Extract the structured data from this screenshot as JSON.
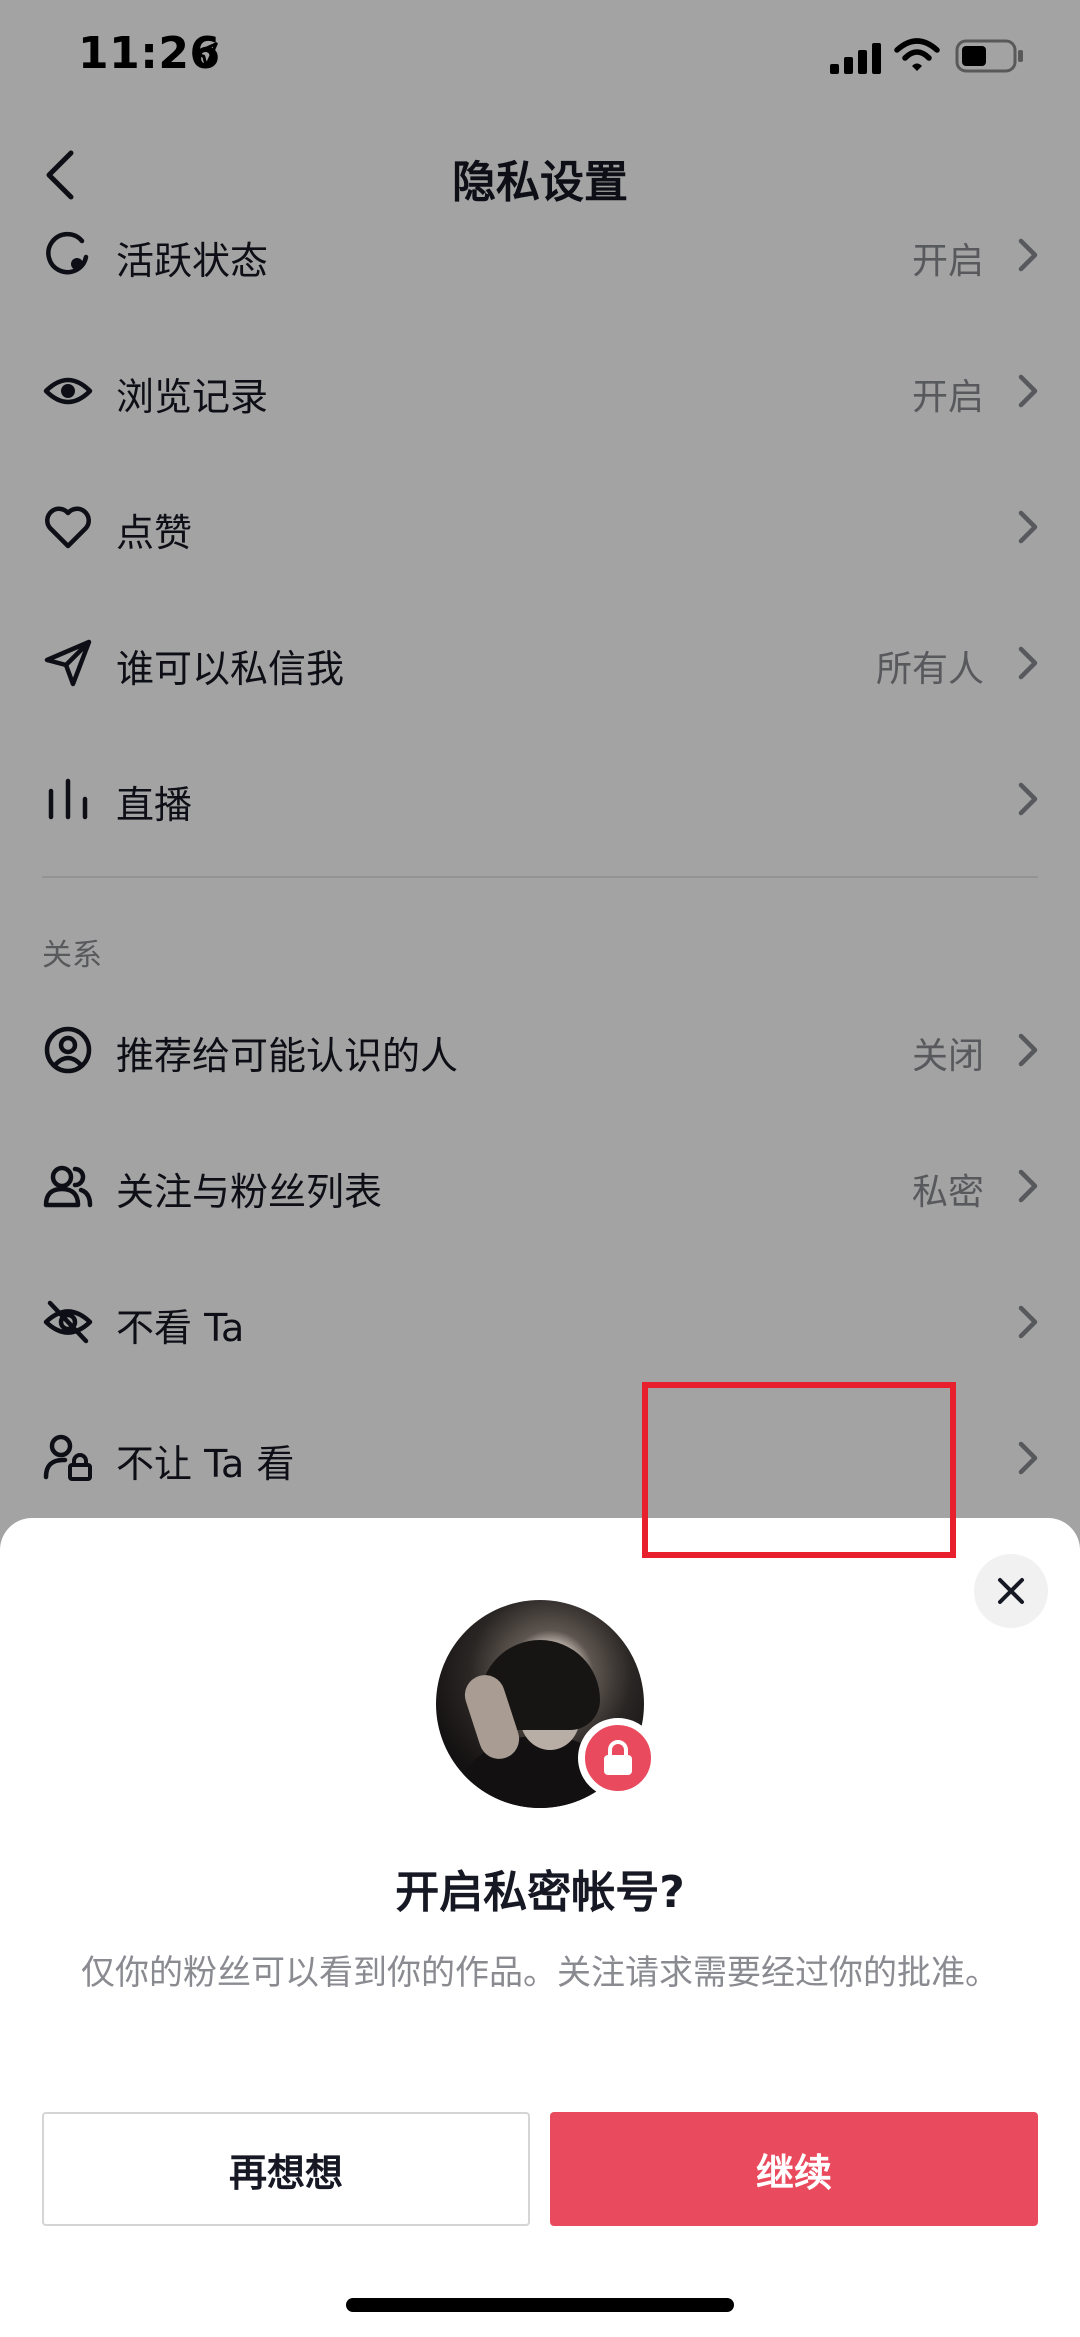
{
  "status_bar": {
    "time": "11:26"
  },
  "nav": {
    "title": "隐私设置"
  },
  "settings": {
    "rows": [
      {
        "label": "活跃状态",
        "value": "开启",
        "icon": "activity-status-icon"
      },
      {
        "label": "浏览记录",
        "value": "开启",
        "icon": "eye-icon"
      },
      {
        "label": "点赞",
        "value": "",
        "icon": "heart-icon"
      },
      {
        "label": "谁可以私信我",
        "value": "所有人",
        "icon": "paper-plane-icon"
      },
      {
        "label": "直播",
        "value": "",
        "icon": "live-bars-icon"
      }
    ],
    "section_relations": "关系",
    "relation_rows": [
      {
        "label": "推荐给可能认识的人",
        "value": "关闭",
        "icon": "person-circle-icon"
      },
      {
        "label": "关注与粉丝列表",
        "value": "私密",
        "icon": "people-icon"
      },
      {
        "label": "不看 Ta",
        "value": "",
        "icon": "eye-off-icon"
      },
      {
        "label": "不让 Ta 看",
        "value": "",
        "icon": "person-lock-icon"
      }
    ]
  },
  "sheet": {
    "title": "开启私密帐号?",
    "description": "仅你的粉丝可以看到你的作品。关注请求需要经过你的批准。",
    "cancel_label": "再想想",
    "continue_label": "继续"
  },
  "colors": {
    "accent": "#ea4a5d",
    "highlight": "#e8202d",
    "text_primary": "#161823",
    "text_secondary": "#8a8b91"
  }
}
